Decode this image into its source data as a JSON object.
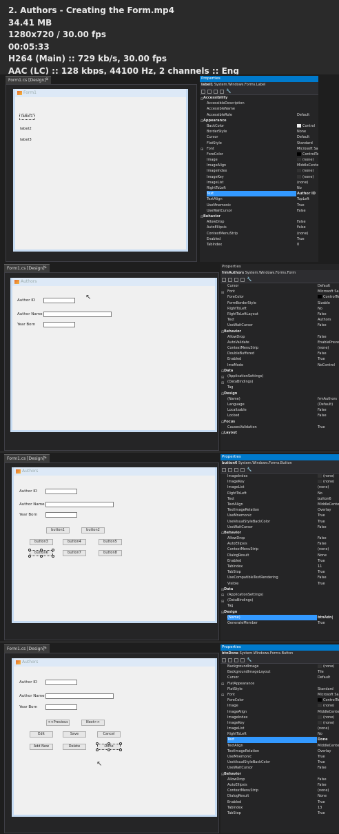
{
  "meta": {
    "line1": "2. Authors - Creating the Form.mp4",
    "line2": "34.41 MB",
    "line3": "1280x720 / 30.00 fps",
    "line4": "00:05:33",
    "line5": "H264 (Main) :: 729 kb/s, 30.00 fps",
    "line6": "AAC (LC) :: 128 kbps, 44100 Hz, 2 channels :: Eng"
  },
  "frames": [
    {
      "tab": "Form1.cs [Design]*",
      "props_title": "Properties",
      "props_object": "label1",
      "props_type": "System.Windows.Forms.Label",
      "form_title": "Form1",
      "labels": [
        "label1",
        "label2",
        "label3"
      ],
      "rows": [
        {
          "k": "cat",
          "n": "Accessibility",
          "v": ""
        },
        {
          "k": "row",
          "n": "AccessibleDescription",
          "v": ""
        },
        {
          "k": "row",
          "n": "AccessibleName",
          "v": ""
        },
        {
          "k": "row",
          "n": "AccessibleRole",
          "v": "Default"
        },
        {
          "k": "cat",
          "n": "Appearance",
          "v": ""
        },
        {
          "k": "row",
          "n": "BackColor",
          "v": "Control",
          "sw": "#f0f0f0"
        },
        {
          "k": "row",
          "n": "BorderStyle",
          "v": "None"
        },
        {
          "k": "row",
          "n": "Cursor",
          "v": "Default"
        },
        {
          "k": "row",
          "n": "FlatStyle",
          "v": "Standard"
        },
        {
          "k": "exp",
          "n": "Font",
          "v": "Microsoft Sans Serif"
        },
        {
          "k": "row",
          "n": "ForeColor",
          "v": "ControlText",
          "sw": "#000"
        },
        {
          "k": "row",
          "n": "Image",
          "v": "(none)",
          "sw": "#333"
        },
        {
          "k": "row",
          "n": "ImageAlign",
          "v": "MiddleCenter"
        },
        {
          "k": "row",
          "n": "ImageIndex",
          "v": "(none)",
          "sw": "#333"
        },
        {
          "k": "row",
          "n": "ImageKey",
          "v": "(none)",
          "sw": "#333"
        },
        {
          "k": "row",
          "n": "ImageList",
          "v": "(none)"
        },
        {
          "k": "row",
          "n": "RightToLeft",
          "v": "No"
        },
        {
          "k": "sel",
          "n": "Text",
          "v": "Author ID"
        },
        {
          "k": "row",
          "n": "TextAlign",
          "v": "TopLeft"
        },
        {
          "k": "row",
          "n": "UseMnemonic",
          "v": "True"
        },
        {
          "k": "row",
          "n": "UseWaitCursor",
          "v": "False"
        },
        {
          "k": "cat",
          "n": "Behavior",
          "v": ""
        },
        {
          "k": "row",
          "n": "AllowDrop",
          "v": "False"
        },
        {
          "k": "row",
          "n": "AutoEllipsis",
          "v": "False"
        },
        {
          "k": "row",
          "n": "ContextMenuStrip",
          "v": "(none)"
        },
        {
          "k": "row",
          "n": "Enabled",
          "v": "True"
        },
        {
          "k": "row",
          "n": "TabIndex",
          "v": "0"
        }
      ]
    },
    {
      "tab": "Form1.cs [Design]*",
      "props_title": "Properties",
      "props_object": "frmAuthors",
      "props_type": "System.Windows.Forms.Form",
      "form_title": "Authors",
      "labels": [
        "Author ID",
        "Author Name",
        "Year Born"
      ],
      "rows": [
        {
          "k": "row",
          "n": "Cursor",
          "v": "Default"
        },
        {
          "k": "exp",
          "n": "Font",
          "v": "Microsoft Sans Serif, 8.25pt"
        },
        {
          "k": "row",
          "n": "ForeColor",
          "v": "ControlText",
          "sw": "#000"
        },
        {
          "k": "row",
          "n": "FormBorderStyle",
          "v": "Sizable"
        },
        {
          "k": "row",
          "n": "RightToLeft",
          "v": "No"
        },
        {
          "k": "row",
          "n": "RightToLeftLayout",
          "v": "False"
        },
        {
          "k": "row",
          "n": "Text",
          "v": "Authors"
        },
        {
          "k": "row",
          "n": "UseWaitCursor",
          "v": "False"
        },
        {
          "k": "cat",
          "n": "Behavior",
          "v": ""
        },
        {
          "k": "row",
          "n": "AllowDrop",
          "v": "False"
        },
        {
          "k": "row",
          "n": "AutoValidate",
          "v": "EnablePreventFocusChange"
        },
        {
          "k": "row",
          "n": "ContextMenuStrip",
          "v": "(none)"
        },
        {
          "k": "row",
          "n": "DoubleBuffered",
          "v": "False"
        },
        {
          "k": "row",
          "n": "Enabled",
          "v": "True"
        },
        {
          "k": "row",
          "n": "ImeMode",
          "v": "NoControl"
        },
        {
          "k": "cat",
          "n": "Data",
          "v": ""
        },
        {
          "k": "exp",
          "n": "(ApplicationSettings)",
          "v": ""
        },
        {
          "k": "exp",
          "n": "(DataBindings)",
          "v": ""
        },
        {
          "k": "row",
          "n": "Tag",
          "v": ""
        },
        {
          "k": "cat",
          "n": "Design",
          "v": ""
        },
        {
          "k": "row",
          "n": "(Name)",
          "v": "frmAuthors"
        },
        {
          "k": "row",
          "n": "Language",
          "v": "(Default)"
        },
        {
          "k": "row",
          "n": "Localizable",
          "v": "False"
        },
        {
          "k": "row",
          "n": "Locked",
          "v": "False"
        },
        {
          "k": "cat",
          "n": "Focus",
          "v": ""
        },
        {
          "k": "row",
          "n": "CausesValidation",
          "v": "True"
        },
        {
          "k": "cat",
          "n": "Layout",
          "v": ""
        }
      ]
    },
    {
      "tab": "Form1.cs [Design]*",
      "props_title": "Properties",
      "props_object": "button6",
      "props_type": "System.Windows.Forms.Button",
      "form_title": "Authors",
      "labels": [
        "Author ID",
        "Author Name",
        "Year Born"
      ],
      "buttons": [
        "button1",
        "button2",
        "button3",
        "button4",
        "button5",
        "button6",
        "button7",
        "button8"
      ],
      "rows": [
        {
          "k": "row",
          "n": "ImageIndex",
          "v": "(none)",
          "sw": "#333"
        },
        {
          "k": "row",
          "n": "ImageKey",
          "v": "(none)",
          "sw": "#333"
        },
        {
          "k": "row",
          "n": "ImageList",
          "v": "(none)"
        },
        {
          "k": "row",
          "n": "RightToLeft",
          "v": "No"
        },
        {
          "k": "row",
          "n": "Text",
          "v": "button6"
        },
        {
          "k": "row",
          "n": "TextAlign",
          "v": "MiddleCenter"
        },
        {
          "k": "row",
          "n": "TextImageRelation",
          "v": "Overlay"
        },
        {
          "k": "row",
          "n": "UseMnemonic",
          "v": "True"
        },
        {
          "k": "row",
          "n": "UseVisualStyleBackColor",
          "v": "True"
        },
        {
          "k": "row",
          "n": "UseWaitCursor",
          "v": "False"
        },
        {
          "k": "cat",
          "n": "Behavior",
          "v": ""
        },
        {
          "k": "row",
          "n": "AllowDrop",
          "v": "False"
        },
        {
          "k": "row",
          "n": "AutoEllipsis",
          "v": "False"
        },
        {
          "k": "row",
          "n": "ContextMenuStrip",
          "v": "(none)"
        },
        {
          "k": "row",
          "n": "DialogResult",
          "v": "None"
        },
        {
          "k": "row",
          "n": "Enabled",
          "v": "True"
        },
        {
          "k": "row",
          "n": "TabIndex",
          "v": "11"
        },
        {
          "k": "row",
          "n": "TabStop",
          "v": "True"
        },
        {
          "k": "row",
          "n": "UseCompatibleTextRendering",
          "v": "False"
        },
        {
          "k": "row",
          "n": "Visible",
          "v": "True"
        },
        {
          "k": "cat",
          "n": "Data",
          "v": ""
        },
        {
          "k": "exp",
          "n": "(ApplicationSettings)",
          "v": ""
        },
        {
          "k": "exp",
          "n": "(DataBindings)",
          "v": ""
        },
        {
          "k": "row",
          "n": "Tag",
          "v": ""
        },
        {
          "k": "cat",
          "n": "Design",
          "v": ""
        },
        {
          "k": "sel",
          "n": "(Name)",
          "v": "btnAdn|"
        },
        {
          "k": "row",
          "n": "GenerateMember",
          "v": "True"
        }
      ]
    },
    {
      "tab": "Form1.cs [Design]*",
      "props_title": "Properties",
      "props_object": "btnDone",
      "props_type": "System.Windows.Forms.Button",
      "form_title": "Authors",
      "labels": [
        "Author ID",
        "Author Name",
        "Year Born"
      ],
      "buttons": [
        "<<Previous",
        "Next>>",
        "Edit",
        "Save",
        "Cancel",
        "Add New",
        "Delete",
        "Done"
      ],
      "rows": [
        {
          "k": "row",
          "n": "BackgroundImage",
          "v": "(none)",
          "sw": "#333"
        },
        {
          "k": "row",
          "n": "BackgroundImageLayout",
          "v": "Tile"
        },
        {
          "k": "row",
          "n": "Cursor",
          "v": "Default"
        },
        {
          "k": "exp",
          "n": "FlatAppearance",
          "v": ""
        },
        {
          "k": "row",
          "n": "FlatStyle",
          "v": "Standard"
        },
        {
          "k": "exp",
          "n": "Font",
          "v": "Microsoft Sans Serif, 8.25pt"
        },
        {
          "k": "row",
          "n": "ForeColor",
          "v": "ControlText",
          "sw": "#000"
        },
        {
          "k": "row",
          "n": "Image",
          "v": "(none)",
          "sw": "#333"
        },
        {
          "k": "row",
          "n": "ImageAlign",
          "v": "MiddleCenter"
        },
        {
          "k": "row",
          "n": "ImageIndex",
          "v": "(none)",
          "sw": "#333"
        },
        {
          "k": "row",
          "n": "ImageKey",
          "v": "(none)",
          "sw": "#333"
        },
        {
          "k": "row",
          "n": "ImageList",
          "v": "(none)"
        },
        {
          "k": "row",
          "n": "RightToLeft",
          "v": "No"
        },
        {
          "k": "sel",
          "n": "Text",
          "v": "Done"
        },
        {
          "k": "row",
          "n": "TextAlign",
          "v": "MiddleCenter"
        },
        {
          "k": "row",
          "n": "TextImageRelation",
          "v": "Overlay"
        },
        {
          "k": "row",
          "n": "UseMnemonic",
          "v": "True"
        },
        {
          "k": "row",
          "n": "UseVisualStyleBackColor",
          "v": "True"
        },
        {
          "k": "row",
          "n": "UseWaitCursor",
          "v": "False"
        },
        {
          "k": "cat",
          "n": "Behavior",
          "v": ""
        },
        {
          "k": "row",
          "n": "AllowDrop",
          "v": "False"
        },
        {
          "k": "row",
          "n": "AutoEllipsis",
          "v": "False"
        },
        {
          "k": "row",
          "n": "ContextMenuStrip",
          "v": "(none)"
        },
        {
          "k": "row",
          "n": "DialogResult",
          "v": "None"
        },
        {
          "k": "row",
          "n": "Enabled",
          "v": "True"
        },
        {
          "k": "row",
          "n": "TabIndex",
          "v": "13"
        },
        {
          "k": "row",
          "n": "TabStop",
          "v": "True"
        }
      ]
    }
  ],
  "colors": {
    "accent": "#3399ff",
    "props_title_active": "#007acc"
  }
}
